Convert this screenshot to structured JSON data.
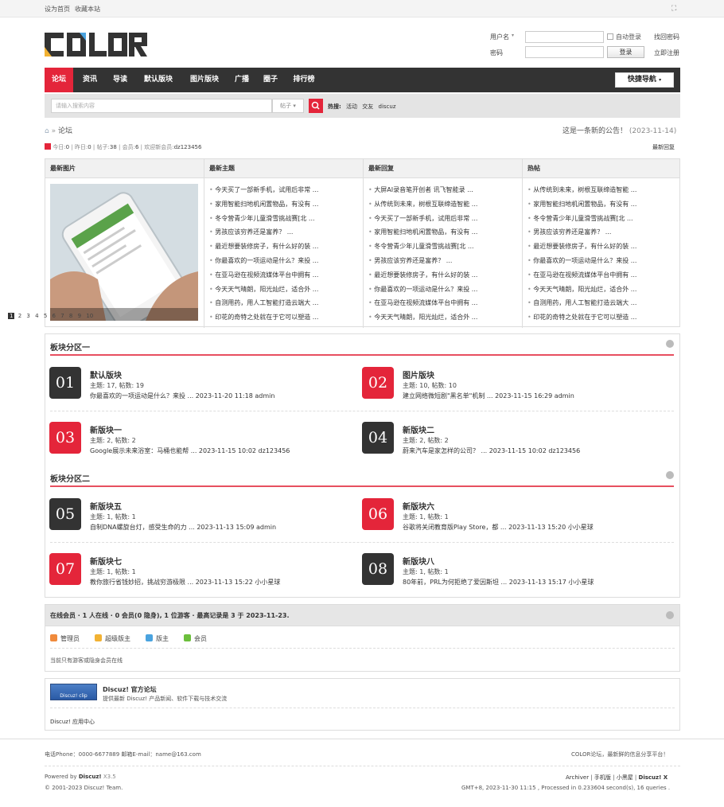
{
  "topbar": {
    "set_home": "设为首页",
    "favorite": "收藏本站"
  },
  "logo": {
    "text": "COLOR"
  },
  "login": {
    "username_label": "用户名",
    "password_label": "密码",
    "auto_login": "自动登录",
    "forgot_password": "找回密码",
    "login_button": "登录",
    "register": "立即注册"
  },
  "nav": {
    "items": [
      "论坛",
      "资讯",
      "导读",
      "默认版块",
      "图片版块",
      "广播",
      "圈子",
      "排行榜"
    ],
    "quick_nav": "快捷导航"
  },
  "search": {
    "placeholder": "请输入搜索内容",
    "type": "帖子",
    "hot_label": "热搜:",
    "hot_terms": [
      "活动",
      "交友",
      "discuz"
    ]
  },
  "breadcrumb": {
    "current": "论坛"
  },
  "notice": {
    "text": "这是一条新的公告！",
    "date": "(2023-11-14)"
  },
  "stats": {
    "today_label": "今日:",
    "today": "0",
    "yesterday_label": "昨日:",
    "yesterday": "0",
    "posts_label": "帖子:",
    "posts": "38",
    "members_label": "会员:",
    "members": "6",
    "welcome_label": "欢迎新会员:",
    "newest_member": "dz123456",
    "latest_reply": "最新回复"
  },
  "columns": {
    "images": {
      "title": "最新图片",
      "pager": [
        "1",
        "2",
        "3",
        "4",
        "5",
        "6",
        "7",
        "8",
        "9",
        "10"
      ]
    },
    "new_topics": {
      "title": "最新主题",
      "items": [
        "今天买了一部新手机，试用后非常 ...",
        "家用智能扫地机闲置物品，有没有 ...",
        "冬令营青少年儿童滑雪挑战赛[北 ...",
        "男孩应该穷养还是富养？ ...",
        "最近想要装修房子，有什么好的装 ...",
        "你最喜欢的一项运动是什么？来投 ...",
        "在亚马逊在视频流媒体平台中拥有 ...",
        "今天天气晴朗，阳光灿烂，适合外 ...",
        "自测用药，用人工智能打造云端大 ...",
        "印花的奇特之处就在于它可以塑造 ..."
      ]
    },
    "new_replies": {
      "title": "最新回复",
      "items": [
        "大屏AI录音笔开创者 讯飞智能录 ...",
        "从传统到未来，树根互联缔造智能 ...",
        "今天买了一部新手机，试用后非常 ...",
        "家用智能扫地机闲置物品，有没有 ...",
        "冬令营青少年儿童滑雪挑战赛[北 ...",
        "男孩应该穷养还是富养？ ...",
        "最近想要装修房子，有什么好的装 ...",
        "你最喜欢的一项运动是什么？来投 ...",
        "在亚马逊在视频流媒体平台中拥有 ...",
        "今天天气晴朗，阳光灿烂，适合外 ..."
      ]
    },
    "hot": {
      "title": "热帖",
      "items": [
        "从传统到未来，树根互联缔造智能 ...",
        "家用智能扫地机闲置物品，有没有 ...",
        "冬令营青少年儿童滑雪挑战赛[北 ...",
        "男孩应该穷养还是富养？ ...",
        "最近想要装修房子，有什么好的装 ...",
        "你最喜欢的一项运动是什么？来投 ...",
        "在亚马逊在视频流媒体平台中拥有 ...",
        "今天天气晴朗，阳光灿烂，适合外 ...",
        "自测用药，用人工智能打造云端大 ...",
        "印花的奇特之处就在于它可以塑造 ..."
      ]
    }
  },
  "sections": [
    {
      "title": "板块分区一",
      "forums": [
        {
          "num": "01",
          "name": "默认版块",
          "meta": "主题: 17, 帖数: 19",
          "last": "你最喜欢的一项运动是什么？来投 ... 2023-11-20 11:18 admin"
        },
        {
          "num": "02",
          "name": "图片版块",
          "meta": "主题: 10, 帖数: 10",
          "last": "建立网络微短剧\"黑名单\"机制 ... 2023-11-15 16:29 admin"
        },
        {
          "num": "03",
          "name": "新版块一",
          "meta": "主题: 2, 帖数: 2",
          "last": "Google展示未来浴室：马桶也能帮 ... 2023-11-15 10:02 dz123456"
        },
        {
          "num": "04",
          "name": "新版块二",
          "meta": "主题: 2, 帖数: 2",
          "last": "蔚来汽车是家怎样的公司？ ... 2023-11-15 10:02 dz123456"
        }
      ]
    },
    {
      "title": "板块分区二",
      "forums": [
        {
          "num": "05",
          "name": "新版块五",
          "meta": "主题: 1, 帖数: 1",
          "last": "自制DNA螺旋台灯，感受生命的力 ... 2023-11-13 15:09 admin"
        },
        {
          "num": "06",
          "name": "新版块六",
          "meta": "主题: 1, 帖数: 1",
          "last": "谷歌将关闭教育版Play Store，都 ... 2023-11-13 15:20 小小星球"
        },
        {
          "num": "07",
          "name": "新版块七",
          "meta": "主题: 1, 帖数: 1",
          "last": "教你旅行省钱妙招，挑战穷游极限 ... 2023-11-13 15:22 小小星球"
        },
        {
          "num": "08",
          "name": "新版块八",
          "meta": "主题: 1, 帖数: 1",
          "last": "80年前，PRL为何拒绝了爱因斯坦 ... 2023-11-13 15:17 小小星球"
        }
      ]
    }
  ],
  "online": {
    "header": "在线会员 · 1 人在线 · 0 会员(0 隐身), 1 位游客 · 最高记录是 3 于 2023-11-23.",
    "legend": [
      {
        "label": "管理员",
        "color": "#f08a3c"
      },
      {
        "label": "超级版主",
        "color": "#f2b233"
      },
      {
        "label": "版主",
        "color": "#4aa3df"
      },
      {
        "label": "会员",
        "color": "#6cbf3c"
      }
    ],
    "note": "当前只有游客或隐身会员在线"
  },
  "links": {
    "badge": "Discuz! clip",
    "title": "Discuz! 官方论坛",
    "desc": "提供最新 Discuz! 产品新闻、软件下载与技术交流",
    "app_center": "Discuz! 应用中心"
  },
  "footer": {
    "contact": "电话Phone：0000-6677889    邮箱E-mail：name@163.com",
    "slogan": "COLOR论坛，最新鲜的信息分享平台！",
    "powered_prefix": "Powered by",
    "powered_brand": "Discuz!",
    "version": "X3.5",
    "copyright": "© 2001-2023 Discuz! Team.",
    "links": [
      "Archiver",
      "手机版",
      "小黑屋",
      "Discuz! X"
    ],
    "runtime": "GMT+8, 2023-11-30 11:15 , Processed in 0.233604 second(s), 16 queries ."
  },
  "colors": {
    "accent": "#e4253a",
    "nav_bg": "#333333"
  }
}
